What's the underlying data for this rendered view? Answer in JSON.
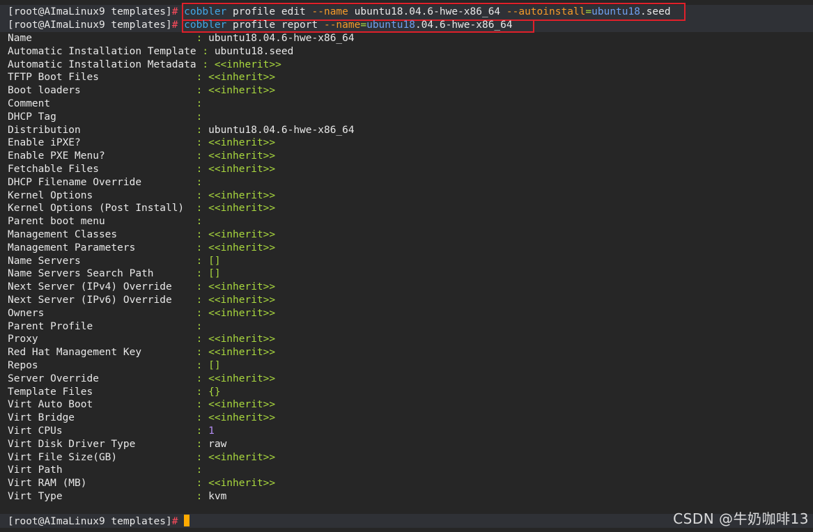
{
  "prompt": {
    "text": "[root@AImaLinux9 templates]",
    "symbol": "#"
  },
  "commands": [
    {
      "program": "cobbler",
      "sub": "profile edit",
      "flag1": "--name",
      "value1": "ubuntu18.04.6-hwe-x86_64",
      "flag2": "--autoinstall",
      "equals": "=",
      "value2_a": "ubuntu18",
      "value2_b": ".seed"
    },
    {
      "program": "cobbler",
      "sub": "profile report",
      "flag1": "--name",
      "equals": "=",
      "value1_a": "ubuntu18",
      "value1_b": ".04.6-hwe-x86_64"
    }
  ],
  "separator": ":",
  "rows": [
    {
      "label": "Name",
      "value": "ubuntu18.04.6-hwe-x86_64"
    },
    {
      "label": "Automatic Installation Template",
      "value": "ubuntu18.seed"
    },
    {
      "label": "Automatic Installation Metadata",
      "value": "<<inherit>>"
    },
    {
      "label": "TFTP Boot Files",
      "value": "<<inherit>>"
    },
    {
      "label": "Boot loaders",
      "value": "<<inherit>>"
    },
    {
      "label": "Comment",
      "value": ""
    },
    {
      "label": "DHCP Tag",
      "value": ""
    },
    {
      "label": "Distribution",
      "value": "ubuntu18.04.6-hwe-x86_64"
    },
    {
      "label": "Enable iPXE?",
      "value": "<<inherit>>"
    },
    {
      "label": "Enable PXE Menu?",
      "value": "<<inherit>>"
    },
    {
      "label": "Fetchable Files",
      "value": "<<inherit>>"
    },
    {
      "label": "DHCP Filename Override",
      "value": ""
    },
    {
      "label": "Kernel Options",
      "value": "<<inherit>>"
    },
    {
      "label": "Kernel Options (Post Install)",
      "value": "<<inherit>>"
    },
    {
      "label": "Parent boot menu",
      "value": ""
    },
    {
      "label": "Management Classes",
      "value": "<<inherit>>"
    },
    {
      "label": "Management Parameters",
      "value": "<<inherit>>"
    },
    {
      "label": "Name Servers",
      "value": "[]"
    },
    {
      "label": "Name Servers Search Path",
      "value": "[]"
    },
    {
      "label": "Next Server (IPv4) Override",
      "value": "<<inherit>>"
    },
    {
      "label": "Next Server (IPv6) Override",
      "value": "<<inherit>>"
    },
    {
      "label": "Owners",
      "value": "<<inherit>>"
    },
    {
      "label": "Parent Profile",
      "value": ""
    },
    {
      "label": "Proxy",
      "value": "<<inherit>>"
    },
    {
      "label": "Red Hat Management Key",
      "value": "<<inherit>>"
    },
    {
      "label": "Repos",
      "value": "[]"
    },
    {
      "label": "Server Override",
      "value": "<<inherit>>"
    },
    {
      "label": "Template Files",
      "value": "{}"
    },
    {
      "label": "Virt Auto Boot",
      "value": "<<inherit>>"
    },
    {
      "label": "Virt Bridge",
      "value": "<<inherit>>"
    },
    {
      "label": "Virt CPUs",
      "value": "1"
    },
    {
      "label": "Virt Disk Driver Type",
      "value": "raw"
    },
    {
      "label": "Virt File Size(GB)",
      "value": "<<inherit>>"
    },
    {
      "label": "Virt Path",
      "value": ""
    },
    {
      "label": "Virt RAM (MB)",
      "value": "<<inherit>>"
    },
    {
      "label": "Virt Type",
      "value": "kvm"
    }
  ],
  "watermark": "CSDN @牛奶咖啡13",
  "colors": {
    "background": "#262626",
    "prompt_bar": "#2f3136",
    "highlight_box": "#e0202a",
    "command": "#41a7e5",
    "flag": "#f59b2a",
    "inherit": "#a9d83e",
    "number": "#b38cf2",
    "cursor": "#ffaa00"
  }
}
